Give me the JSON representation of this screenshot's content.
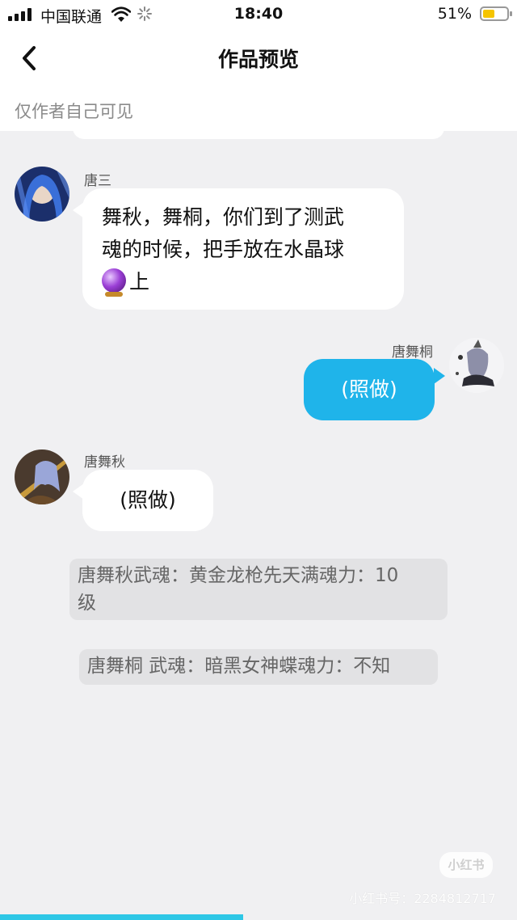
{
  "status_bar": {
    "carrier": "中国联通",
    "time": "18:40",
    "battery_percent": "51%",
    "battery_level": 0.51,
    "battery_color": "#f5c400"
  },
  "nav": {
    "back_icon": "chevron-left-icon",
    "title": "作品预览"
  },
  "visibility_note": "仅作者自己可见",
  "messages": [
    {
      "side": "left",
      "sender": "唐三",
      "lines": [
        "舞秋，舞桐，你们到了测武",
        "魂的时候，把手放在水晶球"
      ],
      "last_line_icon": "crystal-ball-emoji",
      "last_line_text": "上"
    },
    {
      "side": "right",
      "sender": "唐舞桐",
      "text": "(照做)"
    },
    {
      "side": "left",
      "sender": "唐舞秋",
      "text": "(照做)"
    }
  ],
  "system_messages": [
    {
      "lines": [
        "唐舞秋武魂：黄金龙枪先天满魂力：10",
        "级"
      ]
    },
    {
      "lines": [
        "唐舞桐 武魂：暗黑女神蝶魂力：不知"
      ]
    }
  ],
  "watermark": {
    "logo": "小红书",
    "id_text": "小红书号：2284812717"
  },
  "colors": {
    "accent_blue": "#1fb4ea",
    "background": "#f0f0f2",
    "progress": "#2ec7e6"
  },
  "progress_fraction": 0.47
}
